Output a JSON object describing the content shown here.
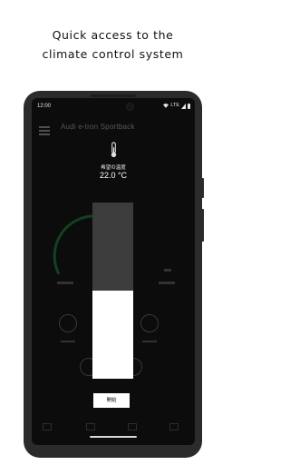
{
  "caption": {
    "line1": "Quick access to the",
    "line2": "climate control system"
  },
  "status_bar": {
    "time": "12:00",
    "network": "LTE"
  },
  "background_app": {
    "car_name": "Audi e-tron Sportback"
  },
  "climate_overlay": {
    "title": "希望の温度",
    "temperature": "22.0 °C",
    "slider_level_percent": 50,
    "start_button": "開始"
  },
  "icons": [
    "menu-icon",
    "thermometer-icon",
    "wifi-icon",
    "signal-icon",
    "battery-icon"
  ]
}
